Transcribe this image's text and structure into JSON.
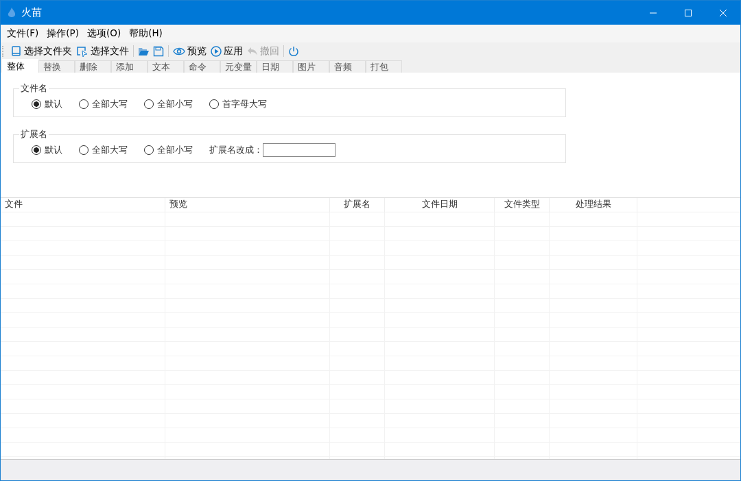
{
  "window": {
    "title": "火苗"
  },
  "menu": [
    "文件(F)",
    "操作(P)",
    "选项(O)",
    "帮助(H)"
  ],
  "toolbar": [
    {
      "kind": "folder",
      "label": "选择文件夹",
      "disabled": false
    },
    {
      "kind": "file",
      "label": "选择文件",
      "disabled": false
    },
    {
      "kind": "sep"
    },
    {
      "kind": "open",
      "disabled": false
    },
    {
      "kind": "save",
      "disabled": false
    },
    {
      "kind": "sep"
    },
    {
      "kind": "preview",
      "label": "预览",
      "disabled": false
    },
    {
      "kind": "apply",
      "label": "应用",
      "disabled": false
    },
    {
      "kind": "undo",
      "label": "撤回",
      "disabled": true
    },
    {
      "kind": "sep"
    },
    {
      "kind": "power",
      "disabled": false
    }
  ],
  "tabs": [
    {
      "label": "整体",
      "selected": true
    },
    {
      "label": "替换",
      "selected": false
    },
    {
      "label": "删除",
      "selected": false
    },
    {
      "label": "添加",
      "selected": false
    },
    {
      "label": "文本",
      "selected": false
    },
    {
      "label": "命令",
      "selected": false
    },
    {
      "label": "元变量",
      "selected": false
    },
    {
      "label": "日期",
      "selected": false
    },
    {
      "label": "图片",
      "selected": false
    },
    {
      "label": "音频",
      "selected": false
    },
    {
      "label": "打包",
      "selected": false
    }
  ],
  "groups": [
    {
      "title": "文件名",
      "options": [
        {
          "label": "默认",
          "selected": true
        },
        {
          "label": "全部大写",
          "selected": false
        },
        {
          "label": "全部小写",
          "selected": false
        },
        {
          "label": "首字母大写",
          "selected": false
        }
      ]
    },
    {
      "title": "扩展名",
      "options": [
        {
          "label": "默认",
          "selected": true
        },
        {
          "label": "全部大写",
          "selected": false
        },
        {
          "label": "全部小写",
          "selected": false
        }
      ],
      "field": {
        "label": "扩展名改成："
      }
    }
  ],
  "table": {
    "columns": [
      "文件",
      "预览",
      "扩展名",
      "文件日期",
      "文件类型",
      "处理结果"
    ]
  }
}
